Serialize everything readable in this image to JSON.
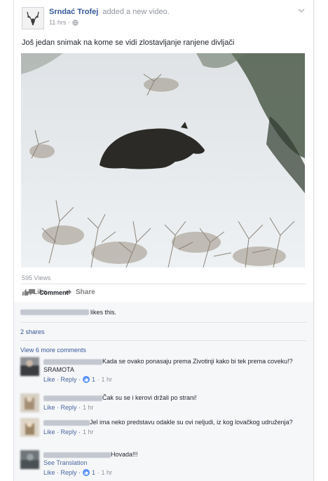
{
  "post": {
    "author": "Srndać Trofej",
    "action": "added a new video.",
    "time": "11 hrs ·",
    "text": "Još jedan snimak na kome se vidi zlostavljanje ranjene divljači",
    "views": "595 Views"
  },
  "actions": {
    "like": "Like",
    "comment": "Comment",
    "share": "Share"
  },
  "ufi": {
    "likes_suffix": "likes this.",
    "shares": "2 shares",
    "more_comments": "View 6 more comments"
  },
  "comments": [
    {
      "text": "Kada se ovako ponasaju prema Zivotinji kako bi tek prema coveku!? SRAMOTA",
      "reply_label": "Like · Reply ·",
      "reaction_count": "1",
      "time": "· 1 hr"
    },
    {
      "text": "Čak su se i kerovi držali po strani!",
      "reply_label": "Like · Reply ·",
      "time": "1 hr"
    },
    {
      "text": "Jel ima neko predstavu odakle su ovi neljudi, iz kog lovačkog udruženja?",
      "reply_label": "Like · Reply ·",
      "time": "1 hr"
    },
    {
      "text": "Hovada!!!",
      "translation": "See Translation",
      "reply_label": "Like · Reply ·",
      "reaction_count": "1",
      "time": "· 1 hr"
    }
  ],
  "icons": {
    "avatar": "deer-antlers-icon",
    "privacy": "globe-icon",
    "options": "chevron-down-icon",
    "like": "thumbs-up-icon",
    "comment": "comment-bubble-icon",
    "share": "share-arrow-icon"
  },
  "colors": {
    "link": "#365899",
    "meta": "#90949c",
    "ufi_background": "#f6f7f9"
  }
}
